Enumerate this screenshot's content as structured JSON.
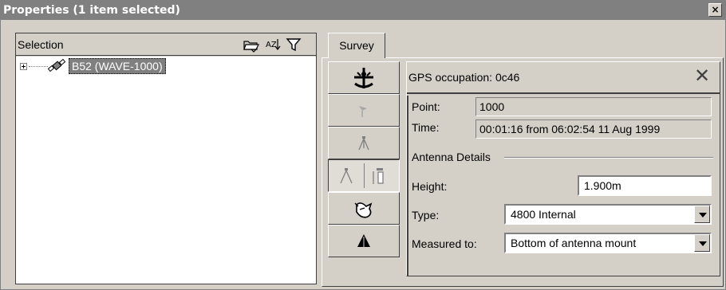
{
  "window": {
    "title": "Properties (1 item selected)",
    "close_glyph": "×"
  },
  "selection_panel": {
    "label": "Selection",
    "header_icons": [
      "folder-icon",
      "sort-az-icon",
      "filter-icon"
    ],
    "sort_text": "AZ",
    "tree": [
      {
        "label": "B52 (WAVE-1000)",
        "icon": "gps-receiver-icon",
        "expanded": false
      }
    ]
  },
  "tabs": [
    {
      "label": "Survey"
    }
  ],
  "toolbar": {
    "buttons": [
      {
        "icon": "sextant-icon",
        "enabled": true,
        "pressed": false
      },
      {
        "icon": "flag-icon",
        "enabled": false,
        "pressed": false
      },
      {
        "icon": "tripod-icon",
        "enabled": false,
        "pressed": false
      },
      {
        "icon": "tripod-and-receiver-icon",
        "enabled": true,
        "pressed": true
      },
      {
        "icon": "satellite-icon",
        "enabled": true,
        "pressed": false
      },
      {
        "icon": "antenna-icon",
        "enabled": true,
        "pressed": false
      }
    ]
  },
  "gps_occupation": {
    "title": "GPS occupation: 0c46",
    "close_glyph": "✕",
    "point_label": "Point:",
    "point_value": "1000",
    "time_label": "Time:",
    "time_value": "00:01:16 from 06:02:54 11 Aug 1999",
    "antenna_group_label": "Antenna Details",
    "height_label": "Height:",
    "height_value": "1.900m",
    "type_label": "Type:",
    "type_value": "4800 Internal",
    "measured_label": "Measured to:",
    "measured_value": "Bottom of antenna mount"
  },
  "colors": {
    "face": "#d4d0c8",
    "titlebar": "#808080",
    "selection_highlight": "#808080"
  }
}
